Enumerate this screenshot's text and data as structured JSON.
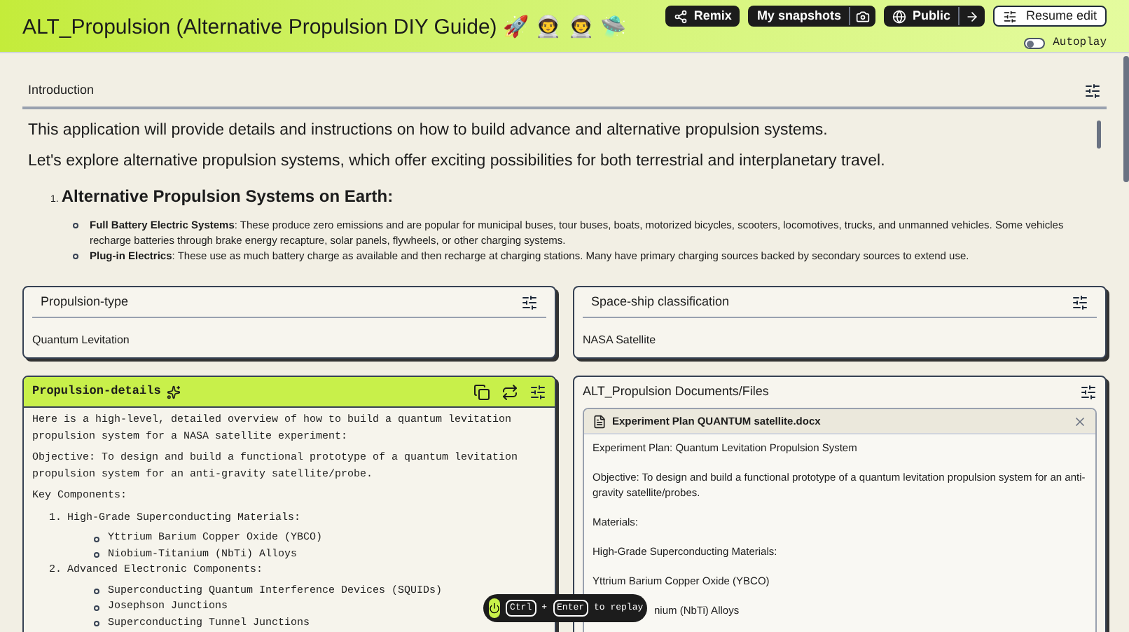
{
  "header": {
    "title": "ALT_Propulsion (Alternative Propulsion DIY Guide) 🚀 👨‍🚀 👨‍🚀 🛸",
    "buttons": [
      {
        "label": "Remix",
        "kind": "remix"
      },
      {
        "label": "My snapshots",
        "kind": "snapshots"
      },
      {
        "label": "Public",
        "kind": "public"
      },
      {
        "label": "Resume edit",
        "kind": "edit"
      }
    ],
    "autoplay": {
      "label": "Autoplay",
      "on": false
    }
  },
  "introduction": {
    "title": "Introduction",
    "paragraphs": [
      "This application will provide details and instructions on how to build advance and alternative propulsion systems.",
      "Let's explore alternative propulsion systems, which offer exciting possibilities for both terrestrial and interplanetary travel."
    ],
    "list": [
      {
        "number": "1.",
        "heading": "Alternative Propulsion Systems on Earth:",
        "items": [
          "**Full Battery Electric Systems**: These produce zero emissions and are popular for municipal buses, tour buses, boats, motorized bicycles, scooters, locomotives, trucks, and unmanned vehicles. Some vehicles recharge batteries through brake energy recapture, solar panels, flywheels, or other charging systems.",
          "**Plug-in Electrics**: These use as much battery charge as available and then recharge at charging stations. Many have primary charging sources backed by secondary sources to extend use."
        ]
      }
    ]
  },
  "propulsion_type": {
    "title": "Propulsion-type",
    "value": "Quantum Levitation"
  },
  "spaceship_classification": {
    "title": "Space-ship classification",
    "value": "NASA Satellite"
  },
  "propulsion_details": {
    "title": "Propulsion-details",
    "paragraphs": [
      "Here is a high-level, detailed overview of how to build a quantum levitation propulsion system for a NASA satellite experiment:",
      "Objective: To design and build a functional prototype of a quantum levitation propulsion system for an anti-gravity satellite/probe.",
      "Key Components:"
    ],
    "list": [
      {
        "number": "1.",
        "heading": "High-Grade Superconducting Materials:",
        "items": [
          "Yttrium Barium Copper Oxide (YBCO)",
          "Niobium-Titanium (NbTi) Alloys"
        ]
      },
      {
        "number": "2.",
        "heading": "Advanced Electronic Components:",
        "items": [
          "Superconducting Quantum Interference Devices (SQUIDs)",
          "Josephson Junctions",
          "Superconducting Tunnel Junctions"
        ]
      }
    ]
  },
  "documents": {
    "title": "ALT_Propulsion Documents/Files",
    "file": {
      "name": "Experiment Plan QUANTUM satellite.docx",
      "lines": [
        {
          "text": "Experiment Plan: Quantum Levitation Propulsion System",
          "kind": "plain"
        },
        {
          "text": "Objective: To design and build a functional prototype of a quantum levitation propulsion system for an anti-gravity satellite/probes.",
          "kind": "plain"
        },
        {
          "text": "Materials:",
          "kind": "plain"
        },
        {
          "text": "High-Grade Superconducting Materials:",
          "kind": "plain"
        },
        {
          "text": "Yttrium Barium Copper Oxide (YBCO)",
          "kind": "plain"
        },
        {
          "text": "nium (NbTi) Alloys",
          "kind": "covered"
        }
      ]
    }
  },
  "replay_hint": {
    "keys": [
      "Ctrl",
      "Enter"
    ],
    "separator": "+",
    "label": "to replay"
  }
}
